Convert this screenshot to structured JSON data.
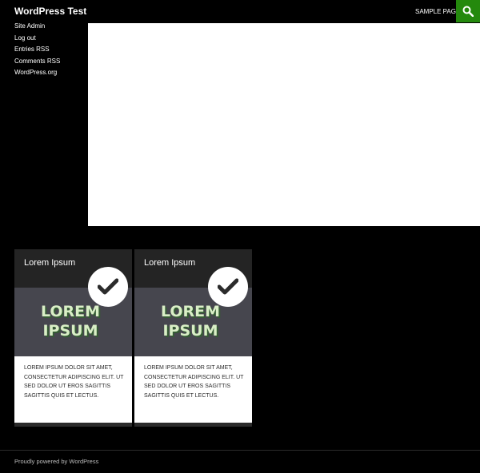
{
  "header": {
    "site_title": "WordPress Test",
    "nav": [
      "SAMPLE PAGE"
    ],
    "search_icon": "search-icon",
    "accent": "#24890d"
  },
  "sidebar": {
    "links": [
      "Site Admin",
      "Log out",
      "Entries RSS",
      "Comments RSS",
      "WordPress.org"
    ]
  },
  "cards": [
    {
      "title": "Lorem Ipsum",
      "image_text": "LOREM IPSUM",
      "text": "LOREM IPSUM DOLOR SIT AMET, CONSECTETUR ADIPISCING ELIT. UT SED DOLOR UT EROS SAGITTIS SAGITTIS QUIS ET LECTUS.",
      "badge_icon": "check-icon"
    },
    {
      "title": "Lorem Ipsum",
      "image_text": "LOREM IPSUM",
      "text": "LOREM IPSUM DOLOR SIT AMET, CONSECTETUR ADIPISCING ELIT. UT SED DOLOR UT EROS SAGITTIS SAGITTIS QUIS ET LECTUS.",
      "badge_icon": "check-icon"
    }
  ],
  "footer": {
    "credit": "Proudly powered by WordPress"
  }
}
